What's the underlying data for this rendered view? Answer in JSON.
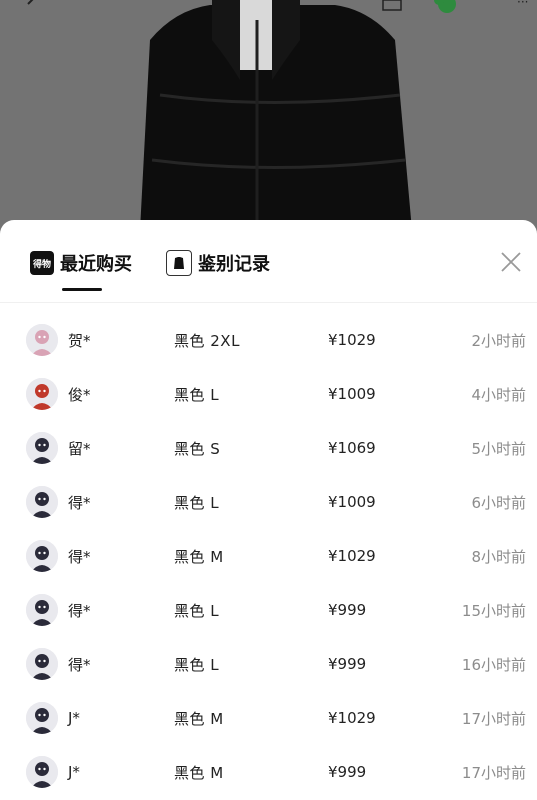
{
  "tabs": [
    {
      "label": "最近购买",
      "logo_text": "得物"
    },
    {
      "label": "鉴别记录"
    }
  ],
  "purchases": [
    {
      "name": "贺*",
      "spec": "黑色 2XL",
      "price": "¥1029",
      "time": "2小时前",
      "avatar_color": "#d9a3b5"
    },
    {
      "name": "俊*",
      "spec": "黑色 L",
      "price": "¥1009",
      "time": "4小时前",
      "avatar_color": "#c0392b"
    },
    {
      "name": "留*",
      "spec": "黑色 S",
      "price": "¥1069",
      "time": "5小时前",
      "avatar_color": "#2b2b3a"
    },
    {
      "name": "得*",
      "spec": "黑色 L",
      "price": "¥1009",
      "time": "6小时前",
      "avatar_color": "#2b2b3a"
    },
    {
      "name": "得*",
      "spec": "黑色 M",
      "price": "¥1029",
      "time": "8小时前",
      "avatar_color": "#2b2b3a"
    },
    {
      "name": "得*",
      "spec": "黑色 L",
      "price": "¥999",
      "time": "15小时前",
      "avatar_color": "#2b2b3a"
    },
    {
      "name": "得*",
      "spec": "黑色 L",
      "price": "¥999",
      "time": "16小时前",
      "avatar_color": "#2b2b3a"
    },
    {
      "name": "J*",
      "spec": "黑色 M",
      "price": "¥1029",
      "time": "17小时前",
      "avatar_color": "#2b2b3a"
    },
    {
      "name": "J*",
      "spec": "黑色 M",
      "price": "¥999",
      "time": "17小时前",
      "avatar_color": "#2b2b3a"
    }
  ]
}
